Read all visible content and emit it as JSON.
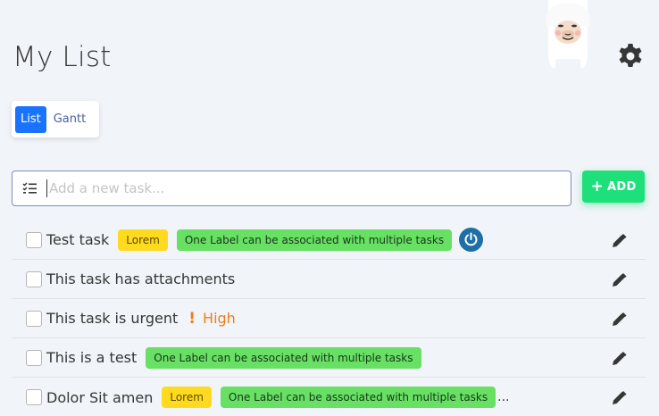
{
  "page": {
    "title": "My List"
  },
  "views": [
    {
      "label": "List",
      "active": true
    },
    {
      "label": "Gantt",
      "active": false
    }
  ],
  "add_task": {
    "placeholder": "Add a new task...",
    "value": "",
    "button_label": "ADD"
  },
  "tasks": [
    {
      "text": "Test task",
      "labels": [
        {
          "text": "Lorem",
          "color": "yellow"
        },
        {
          "text": "One Label can be associated with multiple tasks",
          "color": "green"
        }
      ],
      "has_timer": true
    },
    {
      "text": "This task has attachments",
      "labels": []
    },
    {
      "text": "This task is urgent",
      "priority": {
        "symbol": "!",
        "text": "High"
      },
      "labels": []
    },
    {
      "text": "This is a test",
      "labels": [
        {
          "text": "One Label can be associated with multiple tasks",
          "color": "green"
        }
      ]
    },
    {
      "text": "Dolor Sit amen",
      "labels": [
        {
          "text": "Lorem",
          "color": "yellow"
        },
        {
          "text": "One Label can be associated with multiple tasks",
          "color": "green"
        }
      ],
      "ellipsis": "..."
    }
  ],
  "colors": {
    "primary": "#1973ff",
    "success": "#1ee07a",
    "label_yellow": "#ffda1f",
    "label_green": "#68e064",
    "priority_high": "#ee7d1b",
    "timer": "#1d6fa5"
  },
  "icons": {
    "settings": "gear-icon",
    "list": "checklist-icon",
    "edit": "pencil-icon",
    "timer": "power-icon",
    "mascot": "llama-mascot"
  }
}
